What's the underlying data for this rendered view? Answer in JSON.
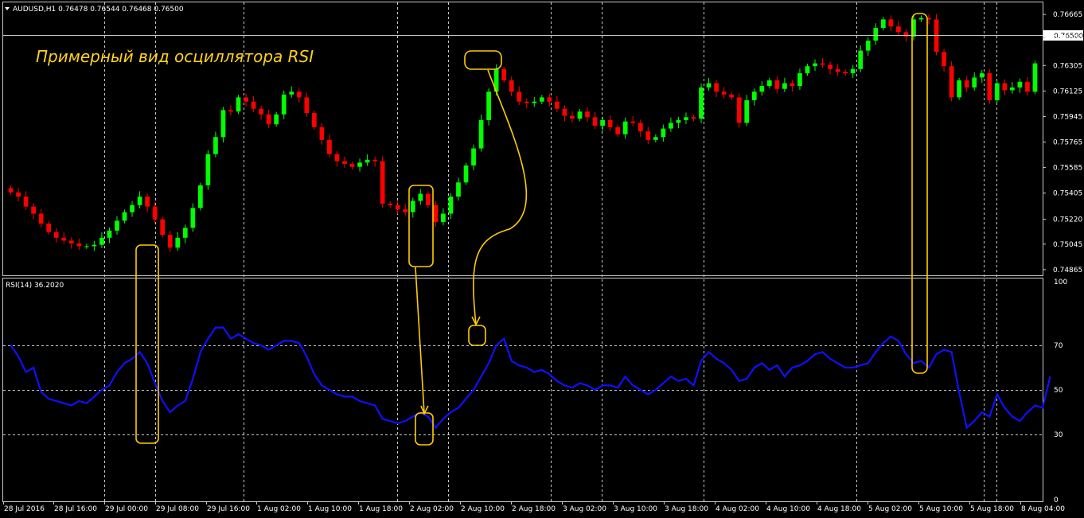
{
  "symbol_header": "AUDUSD,H1  0.76478 0.76544 0.76468 0.76500",
  "annotation": "Примерный вид осциллятора RSI",
  "indicator_header": "RSI(14) 36.2020",
  "colors": {
    "bull": "#00ff00",
    "bear": "#ff0000",
    "rsi": "#1010ff",
    "grid": "#c8c8c8",
    "highlight": "#ffcc00",
    "text": "#ffffff"
  },
  "chart_data": [
    {
      "type": "candlestick",
      "symbol": "AUDUSD",
      "timeframe": "H1",
      "ohlc_header": [
        0.76478,
        0.76544,
        0.76468,
        0.765
      ],
      "current_price_label": "0.76500",
      "current_price": 0.765,
      "ylim": [
        0.74825,
        0.7675
      ],
      "price_ticks": [
        "0.76665",
        "0.76500",
        "0.76305",
        "0.76125",
        "0.75945",
        "0.75765",
        "0.75585",
        "0.75405",
        "0.75220",
        "0.75045",
        "0.74865"
      ],
      "closes": [
        0.7541,
        0.7538,
        0.7531,
        0.7526,
        0.7519,
        0.7513,
        0.7509,
        0.7507,
        0.7505,
        0.7503,
        0.7503,
        0.7504,
        0.7509,
        0.7514,
        0.7521,
        0.7527,
        0.7532,
        0.7538,
        0.7531,
        0.7522,
        0.7511,
        0.7502,
        0.7509,
        0.7516,
        0.753,
        0.7546,
        0.7568,
        0.758,
        0.7599,
        0.7598,
        0.7608,
        0.7605,
        0.76,
        0.7596,
        0.7589,
        0.7596,
        0.761,
        0.7612,
        0.7608,
        0.7597,
        0.7587,
        0.7578,
        0.7568,
        0.7563,
        0.7561,
        0.7559,
        0.7562,
        0.7564,
        0.7563,
        0.7533,
        0.7532,
        0.7529,
        0.7527,
        0.7535,
        0.754,
        0.7532,
        0.752,
        0.7526,
        0.7538,
        0.7548,
        0.756,
        0.7572,
        0.7592,
        0.7612,
        0.7628,
        0.762,
        0.7612,
        0.7605,
        0.7604,
        0.7605,
        0.7608,
        0.7605,
        0.76,
        0.7595,
        0.7593,
        0.7598,
        0.7594,
        0.7588,
        0.7592,
        0.7587,
        0.7582,
        0.7591,
        0.759,
        0.7584,
        0.7578,
        0.758,
        0.7586,
        0.759,
        0.7592,
        0.7594,
        0.7593,
        0.7615,
        0.7618,
        0.7612,
        0.761,
        0.7608,
        0.759,
        0.7606,
        0.7612,
        0.7616,
        0.762,
        0.7614,
        0.7618,
        0.7616,
        0.7625,
        0.763,
        0.7632,
        0.7631,
        0.7628,
        0.7626,
        0.7625,
        0.7628,
        0.7641,
        0.7648,
        0.7657,
        0.7663,
        0.7658,
        0.7654,
        0.7651,
        0.7663,
        0.7664,
        0.7663,
        0.764,
        0.763,
        0.7608,
        0.762,
        0.7615,
        0.7622,
        0.7625,
        0.7606,
        0.7618,
        0.7613,
        0.7615,
        0.7619,
        0.7612,
        0.7632
      ]
    },
    {
      "type": "line",
      "name": "RSI(14)",
      "last_value": 36.202,
      "ylim": [
        0,
        100
      ],
      "y_ticks": [
        "100",
        "70",
        "50",
        "30",
        "0"
      ],
      "levels": [
        70,
        50,
        30
      ],
      "values": [
        70,
        65,
        58,
        60,
        49,
        46,
        45,
        44,
        43,
        45,
        44,
        47,
        50,
        52,
        58,
        62,
        64,
        67,
        62,
        53,
        45,
        40,
        43,
        45,
        55,
        67,
        73,
        78,
        78,
        73,
        75,
        73,
        71,
        70,
        68,
        70,
        72,
        72,
        71,
        65,
        57,
        52,
        50,
        48,
        47,
        47,
        45,
        44,
        43,
        37,
        36,
        35,
        36,
        38,
        40,
        38,
        33,
        37,
        40,
        42,
        46,
        50,
        56,
        62,
        70,
        73,
        63,
        61,
        60,
        58,
        59,
        57,
        54,
        52,
        51,
        53,
        52,
        50,
        52,
        52,
        51,
        56,
        52,
        50,
        48,
        50,
        53,
        56,
        54,
        55,
        52,
        63,
        67,
        64,
        62,
        59,
        54,
        55,
        60,
        62,
        59,
        61,
        56,
        60,
        61,
        63,
        66,
        67,
        64,
        62,
        60,
        60,
        61,
        62,
        67,
        71,
        74,
        72,
        66,
        62,
        63,
        60,
        66,
        68,
        67,
        49,
        33,
        36,
        40,
        38,
        48,
        42,
        38,
        36,
        40,
        43,
        42,
        56
      ]
    }
  ],
  "time_labels": [
    "28 Jul 2016",
    "28 Jul 16:00",
    "29 Jul 00:00",
    "29 Jul 08:00",
    "29 Jul 16:00",
    "1 Aug 02:00",
    "1 Aug 10:00",
    "1 Aug 18:00",
    "2 Aug 02:00",
    "2 Aug 10:00",
    "2 Aug 18:00",
    "3 Aug 02:00",
    "3 Aug 10:00",
    "3 Aug 18:00",
    "4 Aug 02:00",
    "4 Aug 10:00",
    "4 Aug 18:00",
    "5 Aug 02:00",
    "5 Aug 10:00",
    "5 Aug 18:00",
    "8 Aug 04:00"
  ]
}
